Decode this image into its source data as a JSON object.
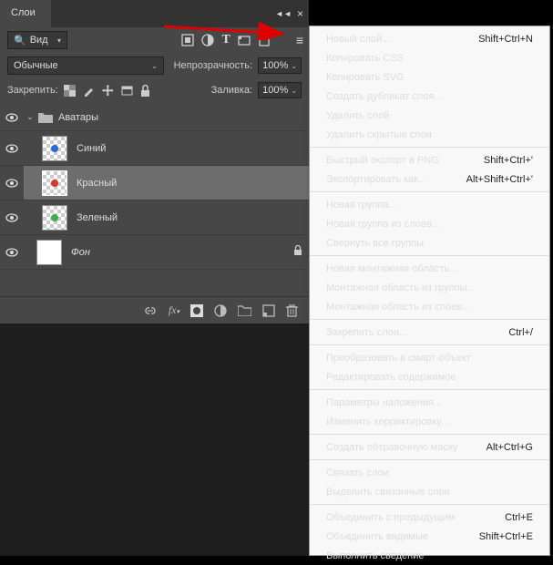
{
  "panel": {
    "tab": "Слои",
    "viewMode": "Вид",
    "blendMode": "Обычные",
    "opacityLabel": "Непрозрачность:",
    "opacityValue": "100%",
    "lockLabel": "Закрепить:",
    "fillLabel": "Заливка:",
    "fillValue": "100%"
  },
  "layers": {
    "group": "Аватары",
    "blue": "Синий",
    "red": "Красный",
    "green": "Зеленый",
    "bg": "Фон"
  },
  "menu": {
    "newLayer": "Новый слой...",
    "newLayerSc": "Shift+Ctrl+N",
    "copyCSS": "Копировать CSS",
    "copySVG": "Копировать SVG",
    "duplicate": "Создать дубликат слоя...",
    "delete": "Удалить слой",
    "deleteHidden": "Удалить скрытые слои",
    "quickExport": "Быстрый экспорт в PNG",
    "quickExportSc": "Shift+Ctrl+'",
    "exportAs": "Экспортировать как...",
    "exportAsSc": "Alt+Shift+Ctrl+'",
    "newGroup": "Новая группа...",
    "groupFromLayers": "Новая группа из слоев...",
    "collapseGroups": "Свернуть все группы",
    "newArtboard": "Новая монтажная область...",
    "artboardFromGroup": "Монтажная область из группы...",
    "artboardFromLayers": "Монтажная область из слоев...",
    "lockLayers": "Закрепить слои...",
    "lockLayersSc": "Ctrl+/",
    "convertSmart": "Преобразовать в смарт-объект",
    "editContents": "Редактировать содержимое",
    "blendingOptions": "Параметры наложения...",
    "editAdjustment": "Изменить корректировку...",
    "clippingMask": "Создать обтравочную маску",
    "clippingMaskSc": "Alt+Ctrl+G",
    "linkLayers": "Связать слои",
    "selectLinked": "Выделить связанные слои",
    "mergeDown": "Объединить с предыдущим",
    "mergeDownSc": "Ctrl+E",
    "mergeVisible": "Объединить видимые",
    "mergeVisibleSc": "Shift+Ctrl+E",
    "flatten": "Выполнить сведение"
  }
}
